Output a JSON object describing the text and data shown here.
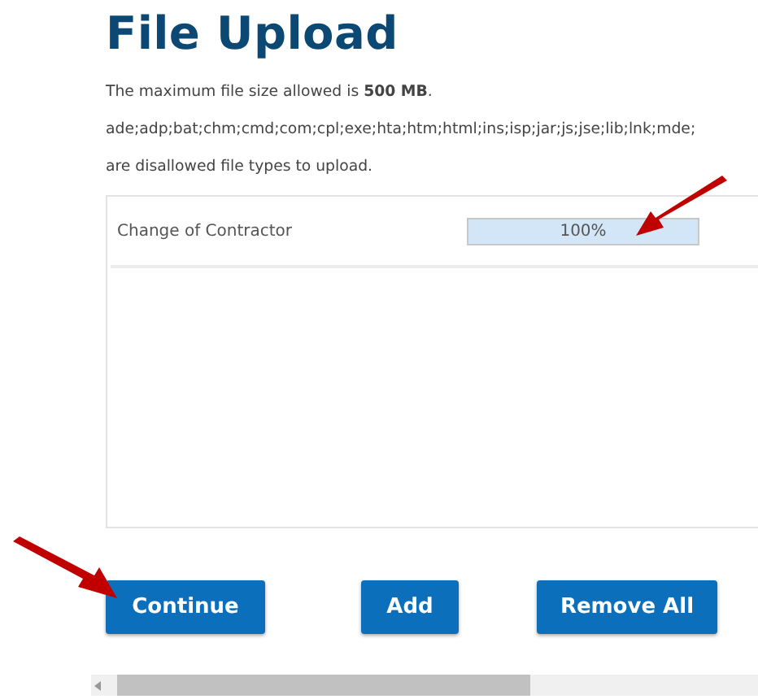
{
  "title": "File Upload",
  "info": [
    "The maximum file size allowed is **500 MB**.",
    "ade;adp;bat;chm;cmd;com;cpl;exe;hta;htm;html;ins;isp;jar;js;jse;lib;lnk;mde;",
    "are disallowed file types to upload."
  ],
  "files": [
    {
      "name": "Change of Contractor",
      "level": 1,
      "reading": "100%"
    }
  ],
  "buttons": [
    "Continue",
    "Add",
    "Remove All"
  ]
}
